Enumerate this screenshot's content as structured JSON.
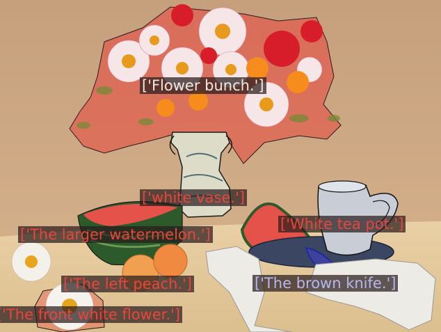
{
  "scene": {
    "background_color": "#c9a583",
    "table_color": "#e4c99b",
    "mask_color": "#e8453d",
    "knife_mask_color": "#3f3fd6"
  },
  "labels": {
    "flower_bunch": "['Flower bunch.']",
    "white_vase": "['white vase.']",
    "larger_watermelon": "['The larger watermelon.']",
    "white_tea_pot": "['White tea pot.']",
    "left_peach": "['The left peach.']",
    "brown_knife": "['The brown knife.']",
    "front_white_flower": "['The front white flower.']"
  }
}
